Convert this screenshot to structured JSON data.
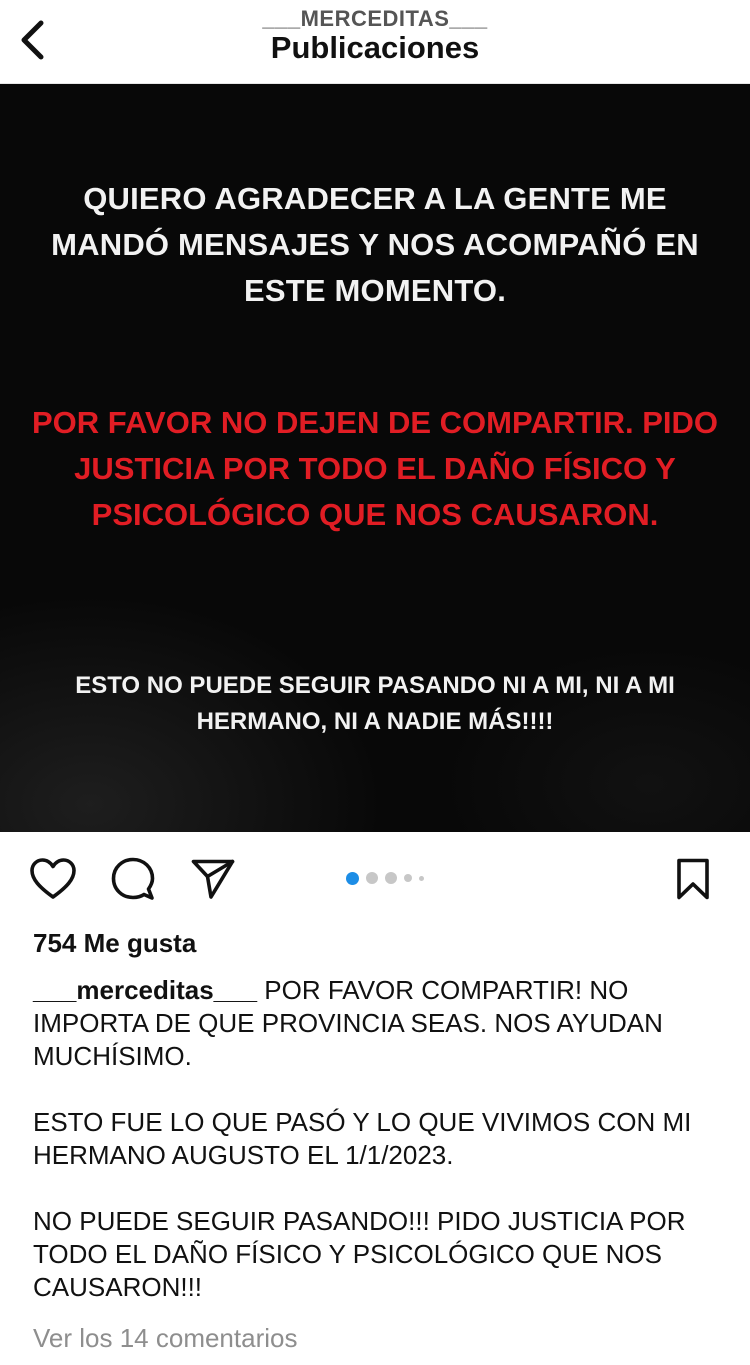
{
  "header": {
    "username": "___MERCEDITAS___",
    "title": "Publicaciones",
    "back_icon": "chevron-left-icon"
  },
  "post_image": {
    "text_line_group_1": "QUIERO AGRADECER A LA GENTE ME MANDÓ MENSAJES Y NOS ACOMPAÑÓ EN ESTE MOMENTO.",
    "text_line_group_2": "POR FAVOR NO DEJEN DE COMPARTIR. PIDO JUSTICIA POR TODO EL DAÑO FÍSICO Y PSICOLÓGICO QUE NOS CAUSARON.",
    "text_line_group_3": "ESTO NO PUEDE SEGUIR PASANDO NI A MI, NI A MI HERMANO, NI A NADIE MÁS!!!!",
    "colors": {
      "background": "#080808",
      "white_text": "#f2f2f2",
      "red_text": "#e11d24"
    }
  },
  "actions": {
    "icons": [
      "heart-icon",
      "comment-icon",
      "share-icon",
      "bookmark-icon"
    ],
    "carousel": {
      "total_visible_dots": 5,
      "active_index": 0,
      "active_color": "#1c8de6"
    }
  },
  "likes": {
    "text": "754 Me gusta"
  },
  "caption": {
    "username": "___merceditas___",
    "para_1_text": " POR FAVOR COMPARTIR! NO IMPORTA DE QUE PROVINCIA SEAS. NOS AYUDAN MUCHÍSIMO.",
    "para_2_text": "ESTO FUE LO QUE PASÓ Y LO QUE VIVIMOS CON MI HERMANO AUGUSTO EL 1/1/2023.",
    "para_3_text": "NO PUEDE SEGUIR PASANDO!!! PIDO JUSTICIA POR TODO EL DAÑO FÍSICO Y PSICOLÓGICO QUE NOS CAUSARON!!!"
  },
  "comments": {
    "view_all_label": "Ver los 14 comentarios"
  }
}
